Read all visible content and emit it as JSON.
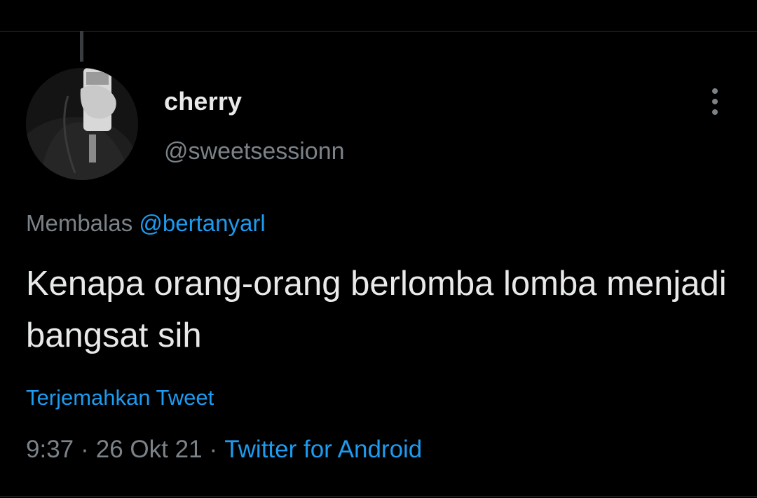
{
  "tweet": {
    "author": {
      "display_name": "cherry",
      "handle": "@sweetsessionn"
    },
    "reply_to": {
      "prefix": "Membalas",
      "mention": "@bertanyarl"
    },
    "text": "Kenapa orang-orang berlomba lomba menjadi bangsat sih",
    "translate_label": "Terjemahkan Tweet",
    "meta": {
      "time": "9:37",
      "separator": "·",
      "date": "26 Okt 21",
      "source": "Twitter for Android"
    }
  },
  "icons": {
    "more": "more-vertical-icon",
    "avatar": "profile-photo"
  },
  "colors": {
    "background": "#000000",
    "text_primary": "#e7e9ea",
    "text_secondary": "#7b8288",
    "link": "#1d9bf0"
  }
}
